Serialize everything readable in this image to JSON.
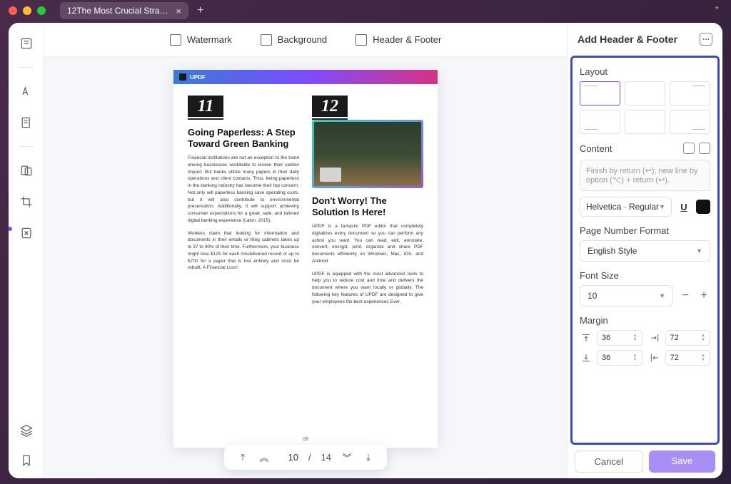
{
  "tab": {
    "title": "12The Most Crucial Strate..."
  },
  "topbar": {
    "watermark": "Watermark",
    "background": "Background",
    "headerfooter": "Header & Footer"
  },
  "pager": {
    "current": "10",
    "sep": "/",
    "total": "14"
  },
  "document": {
    "brand": "UPDF",
    "left": {
      "num": "11",
      "heading": "Going Paperless: A Step Toward Green Banking",
      "p1": "Financial institutions are not an exception to the trend among businesses worldwide to lessen their carbon impact. But banks utilize many papers in their daily operations and client contacts. Thus, being paperless in the banking industry has become their top concern. Not only will paperless banking save operating costs, but it will also contribute to environmental preservation. Additionally, it will support achieving consumer expectations for a great, safe, and tailored digital banking experience (Lalon, 2015).",
      "p2": "Workers claim that looking for information and documents in their emails or filing cabinets takes up to 37 to 40% of their time. Furthermore, your business might lose $125 for each misdelivered record or up to $700 for a paper that is lost entirely and must be rebuilt. A Financial Loss!"
    },
    "right": {
      "num": "12",
      "heading": "Don't Worry! The Solution Is Here!",
      "p1": "UPDF is a fantastic PDF editor that completely digitalizes every document so you can perform any action you want. You can read, edit, annotate, convert, encrypt, print, organize and share PDF documents efficiently on Windows, Mac, iOS, and Android.",
      "p2": "UPDF is equipped with the most advanced tools to help you to reduce cost and time and delivers the document where you want locally or globally. The following key features of UPDF are designed to give your employees the best experiences Ever."
    },
    "pagenum": "08"
  },
  "panel": {
    "title": "Add Header & Footer",
    "layout_label": "Layout",
    "content_label": "Content",
    "content_placeholder": "Finish by return (↩); new line by option (⌥) + return (↩).",
    "font": "Helvetica · Regular",
    "pagenum_label": "Page Number Format",
    "pagenum_value": "English Style",
    "fontsize_label": "Font Size",
    "fontsize_value": "10",
    "margin_label": "Margin",
    "margin_top": "36",
    "margin_right": "72",
    "margin_bottom": "36",
    "margin_left": "72",
    "cancel": "Cancel",
    "save": "Save"
  }
}
